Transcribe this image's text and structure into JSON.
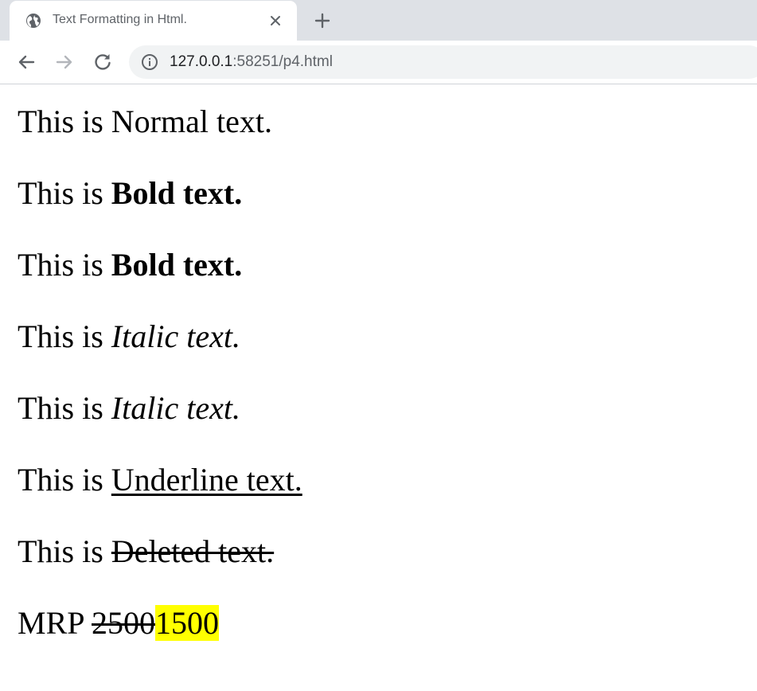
{
  "browser": {
    "tab_title": "Text Formatting in Html.",
    "url_host": "127.0.0.1",
    "url_rest": ":58251/p4.html",
    "icons": {
      "favicon": "globe-icon",
      "close": "close-icon",
      "new_tab": "plus-icon",
      "back": "arrow-left-icon",
      "forward": "arrow-right-icon",
      "reload": "reload-icon",
      "site_info": "info-icon"
    }
  },
  "page": {
    "lines": [
      {
        "prefix": "This is ",
        "text": "Normal text."
      },
      {
        "prefix": "This is ",
        "text": "Bold text."
      },
      {
        "prefix": "This is ",
        "text": "Bold text."
      },
      {
        "prefix": "This is ",
        "text": "Italic text."
      },
      {
        "prefix": "This is ",
        "text": "Italic text."
      },
      {
        "prefix": "This is ",
        "text": "Underline text."
      },
      {
        "prefix": "This is ",
        "text": "Deleted text."
      }
    ],
    "price": {
      "label": "MRP ",
      "old": "2500",
      "new": "1500"
    },
    "colors": {
      "highlight": "#ffff00"
    }
  }
}
